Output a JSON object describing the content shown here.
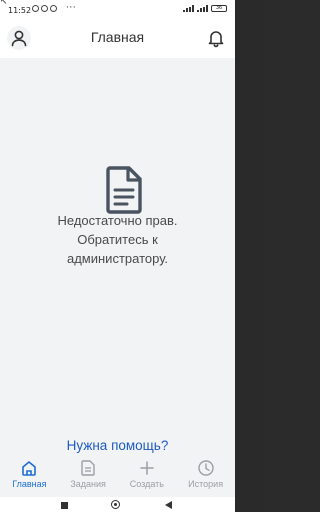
{
  "status_bar": {
    "time": "11:52",
    "overflow": "···",
    "battery": "36"
  },
  "header": {
    "title": "Главная",
    "profile_icon": "user-icon",
    "notification_icon": "bell-icon"
  },
  "main": {
    "icon": "document-icon",
    "message": "Недостаточно прав. Обратитесь к администратору.",
    "help_link": "Нужна помощь?"
  },
  "tabs": [
    {
      "label": "Главная",
      "icon": "home-icon",
      "active": true
    },
    {
      "label": "Задания",
      "icon": "document-icon",
      "active": false
    },
    {
      "label": "Создать",
      "icon": "plus-icon",
      "active": false
    },
    {
      "label": "История",
      "icon": "clock-icon",
      "active": false
    }
  ],
  "colors": {
    "accent": "#1e6fd6",
    "link": "#1e5bc6",
    "background": "#f2f3f5",
    "inactive": "#9aa0a6"
  }
}
